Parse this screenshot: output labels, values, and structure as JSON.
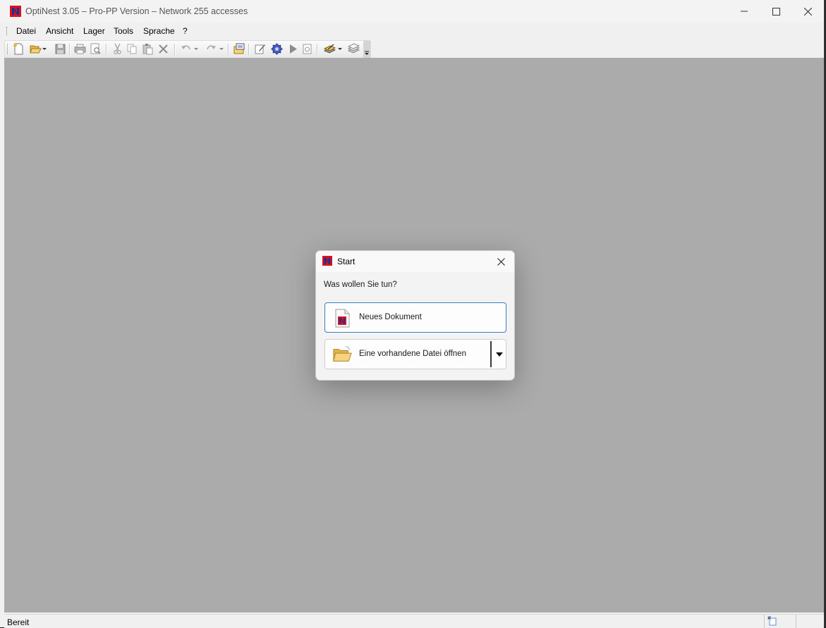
{
  "window": {
    "title": "OptiNest 3.05 – Pro-PP Version – Network 255 accesses",
    "app_icon": "optinest-n-logo"
  },
  "menu": [
    {
      "label": "Datei"
    },
    {
      "label": "Ansicht"
    },
    {
      "label": "Lager"
    },
    {
      "label": "Tools"
    },
    {
      "label": "Sprache"
    },
    {
      "label": "?"
    }
  ],
  "toolbar": {
    "buttons": [
      "new-icon",
      "open-icon",
      "save-icon",
      "print-icon",
      "print-preview-icon",
      "cut-icon",
      "copy-icon",
      "paste-icon",
      "delete-icon",
      "undo-icon",
      "redo-icon",
      "properties-icon",
      "edit-icon",
      "settings-icon",
      "run-icon",
      "report-icon",
      "layers-icon",
      "stack-icon"
    ]
  },
  "dialog": {
    "title": "Start",
    "question": "Was wollen Sie tun?",
    "new_document_label": "Neues Dokument",
    "open_file_label": "Eine vorhandene Datei öffnen"
  },
  "status": {
    "text": "Bereit"
  },
  "colors": {
    "client_background": "#ababab",
    "accent_border": "#3b7ebf",
    "logo_red": "#d8131b",
    "logo_blue": "#1a2fa0"
  }
}
